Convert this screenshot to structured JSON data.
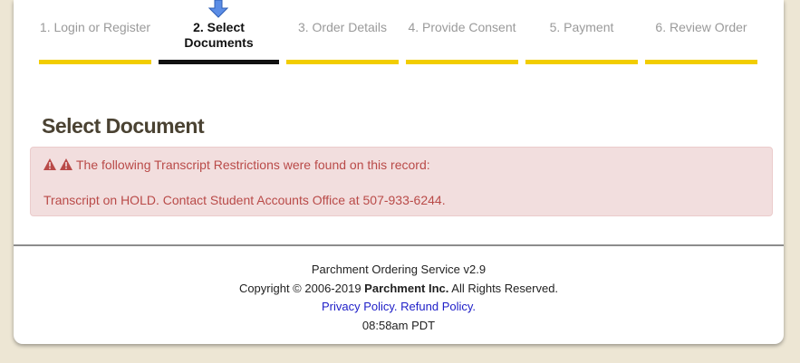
{
  "steps": [
    {
      "label": "1. Login or Register",
      "active": false
    },
    {
      "label_line1": "2. Select",
      "label_line2": "Documents",
      "active": true
    },
    {
      "label": "3. Order Details",
      "active": false
    },
    {
      "label": "4. Provide Consent",
      "active": false
    },
    {
      "label": "5. Payment",
      "active": false
    },
    {
      "label": "6. Review Order",
      "active": false
    }
  ],
  "colors": {
    "step_bar": "#f2cd00",
    "active_bar": "#111111",
    "alert_bg": "#f2dede",
    "alert_text": "#b94a48",
    "link": "#2020c8",
    "arrow": "#5b8de6"
  },
  "icons": {
    "current_step": "arrow-down-icon",
    "warning": "warning-icon"
  },
  "page_title": "Select Document",
  "alert": {
    "heading": "The following Transcript Restrictions were found on this record:",
    "message": "Transcript on HOLD. Contact Student Accounts Office at 507-933-6244."
  },
  "footer": {
    "service": "Parchment Ordering Service v2.9",
    "copyright_prefix": "Copyright © 2006-2019 ",
    "company": "Parchment Inc.",
    "copyright_suffix": " All Rights Reserved.",
    "privacy": "Privacy Policy.",
    "refund": "Refund Policy.",
    "time": "08:58am PDT"
  }
}
